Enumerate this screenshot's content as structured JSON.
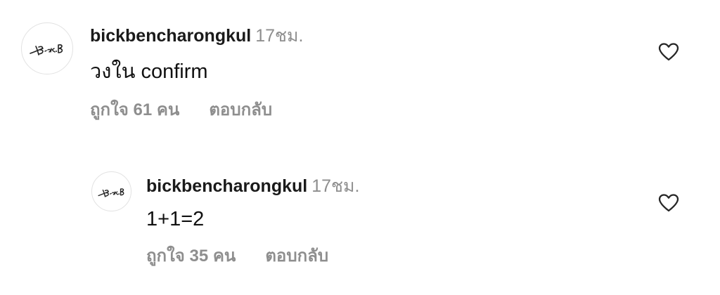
{
  "comments": [
    {
      "username": "bickbencharongkul",
      "timestamp": "17ชม.",
      "text": "วงใน confirm",
      "likes_label": "ถูกใจ 61 คน",
      "reply_label": "ตอบกลับ",
      "avatar_label": "Bick.B"
    },
    {
      "username": "bickbencharongkul",
      "timestamp": "17ชม.",
      "text": "1+1=2",
      "likes_label": "ถูกใจ 35 คน",
      "reply_label": "ตอบกลับ",
      "avatar_label": "Bick.B"
    }
  ],
  "icons": {
    "like": "heart-outline-icon"
  },
  "colors": {
    "text": "#111111",
    "muted": "#8e8e8e"
  }
}
